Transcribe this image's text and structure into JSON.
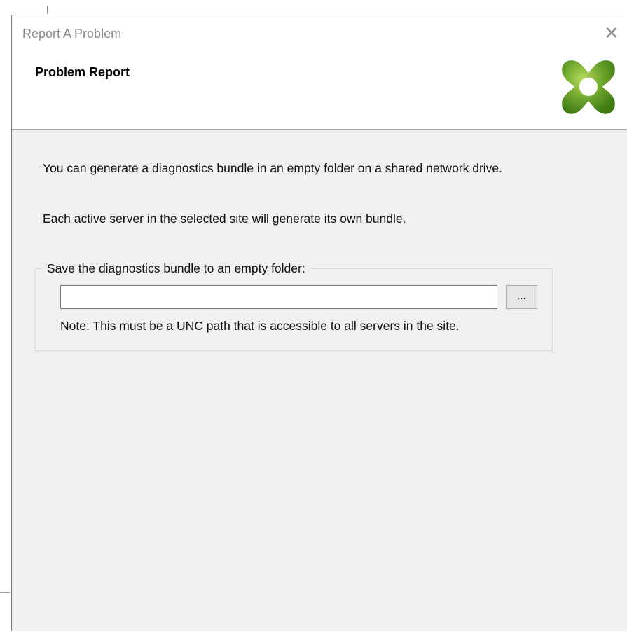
{
  "window": {
    "title": "Report A Problem",
    "close_glyph": "✕"
  },
  "header": {
    "title": "Problem Report",
    "logo_icon": "citrix-x-logo-icon",
    "logo_color": "#6aa32b"
  },
  "main": {
    "paragraph_1": "You can generate a diagnostics bundle in an empty folder on a shared network drive.",
    "paragraph_2": "Each active server in the selected site will generate its own bundle.",
    "group_label": "Save the diagnostics bundle to an empty folder:",
    "path_value": "",
    "browse_label": "...",
    "note": "Note: This must be a UNC path that is accessible to all servers in the site."
  }
}
